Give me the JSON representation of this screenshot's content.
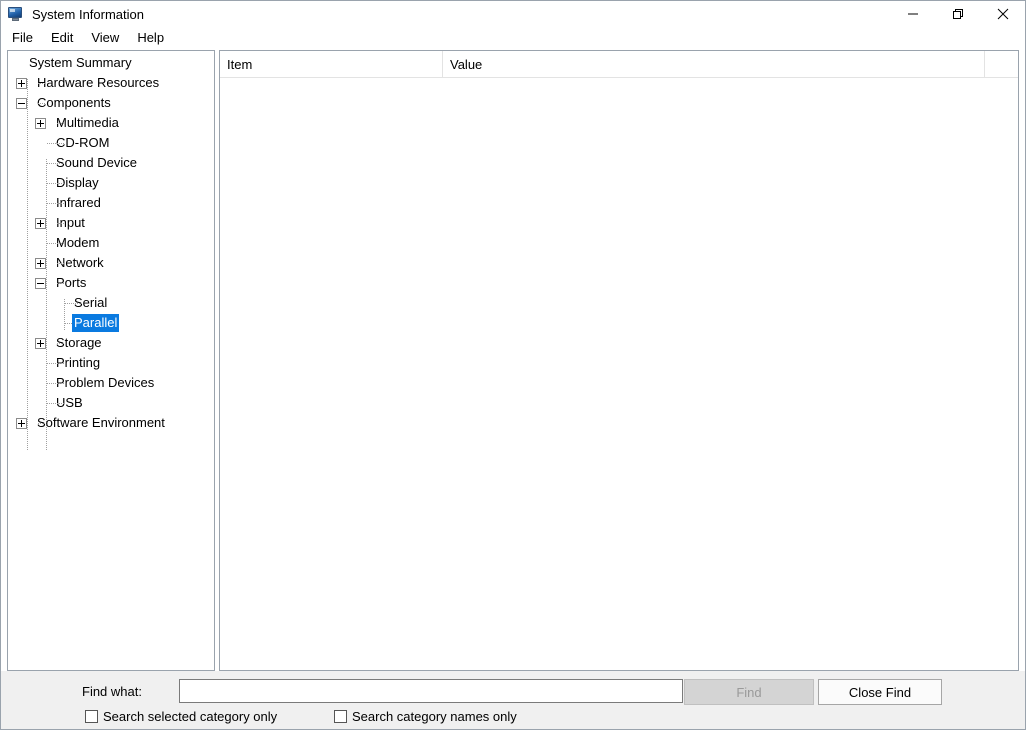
{
  "window": {
    "title": "System Information",
    "icon": "computer-monitor-icon",
    "controls": {
      "minimize": "Minimize",
      "restore": "Restore",
      "close": "Close"
    }
  },
  "menubar": {
    "items": [
      {
        "label": "File"
      },
      {
        "label": "Edit"
      },
      {
        "label": "View"
      },
      {
        "label": "Help"
      }
    ]
  },
  "tree": {
    "nodes": [
      {
        "label": "System Summary",
        "level": 0,
        "state": "none",
        "selected": false
      },
      {
        "label": "Hardware Resources",
        "level": 0,
        "state": "collapsed",
        "selected": false
      },
      {
        "label": "Components",
        "level": 0,
        "state": "expanded",
        "selected": false
      },
      {
        "label": "Multimedia",
        "level": 1,
        "state": "collapsed",
        "selected": false
      },
      {
        "label": "CD-ROM",
        "level": 1,
        "state": "leaf",
        "selected": false
      },
      {
        "label": "Sound Device",
        "level": 1,
        "state": "leaf",
        "selected": false
      },
      {
        "label": "Display",
        "level": 1,
        "state": "leaf",
        "selected": false
      },
      {
        "label": "Infrared",
        "level": 1,
        "state": "leaf",
        "selected": false
      },
      {
        "label": "Input",
        "level": 1,
        "state": "collapsed",
        "selected": false
      },
      {
        "label": "Modem",
        "level": 1,
        "state": "leaf",
        "selected": false
      },
      {
        "label": "Network",
        "level": 1,
        "state": "collapsed",
        "selected": false
      },
      {
        "label": "Ports",
        "level": 1,
        "state": "expanded",
        "selected": false
      },
      {
        "label": "Serial",
        "level": 2,
        "state": "leaf",
        "selected": false
      },
      {
        "label": "Parallel",
        "level": 2,
        "state": "leaf",
        "selected": true
      },
      {
        "label": "Storage",
        "level": 1,
        "state": "collapsed",
        "selected": false
      },
      {
        "label": "Printing",
        "level": 1,
        "state": "leaf",
        "selected": false
      },
      {
        "label": "Problem Devices",
        "level": 1,
        "state": "leaf",
        "selected": false
      },
      {
        "label": "USB",
        "level": 1,
        "state": "leaf",
        "selected": false
      },
      {
        "label": "Software Environment",
        "level": 0,
        "state": "collapsed",
        "selected": false
      }
    ],
    "selection_color": "#0a7ae0"
  },
  "list": {
    "columns": [
      {
        "header": "Item"
      },
      {
        "header": "Value"
      },
      {
        "header": ""
      }
    ],
    "rows": []
  },
  "findbar": {
    "find_label": "Find what:",
    "find_value": "",
    "find_placeholder": "",
    "find_button": "Find",
    "find_button_enabled": false,
    "close_find_button": "Close Find",
    "checkbox_selected_category": {
      "label": "Search selected category only",
      "checked": false
    },
    "checkbox_category_names": {
      "label": "Search category names only",
      "checked": false
    }
  }
}
